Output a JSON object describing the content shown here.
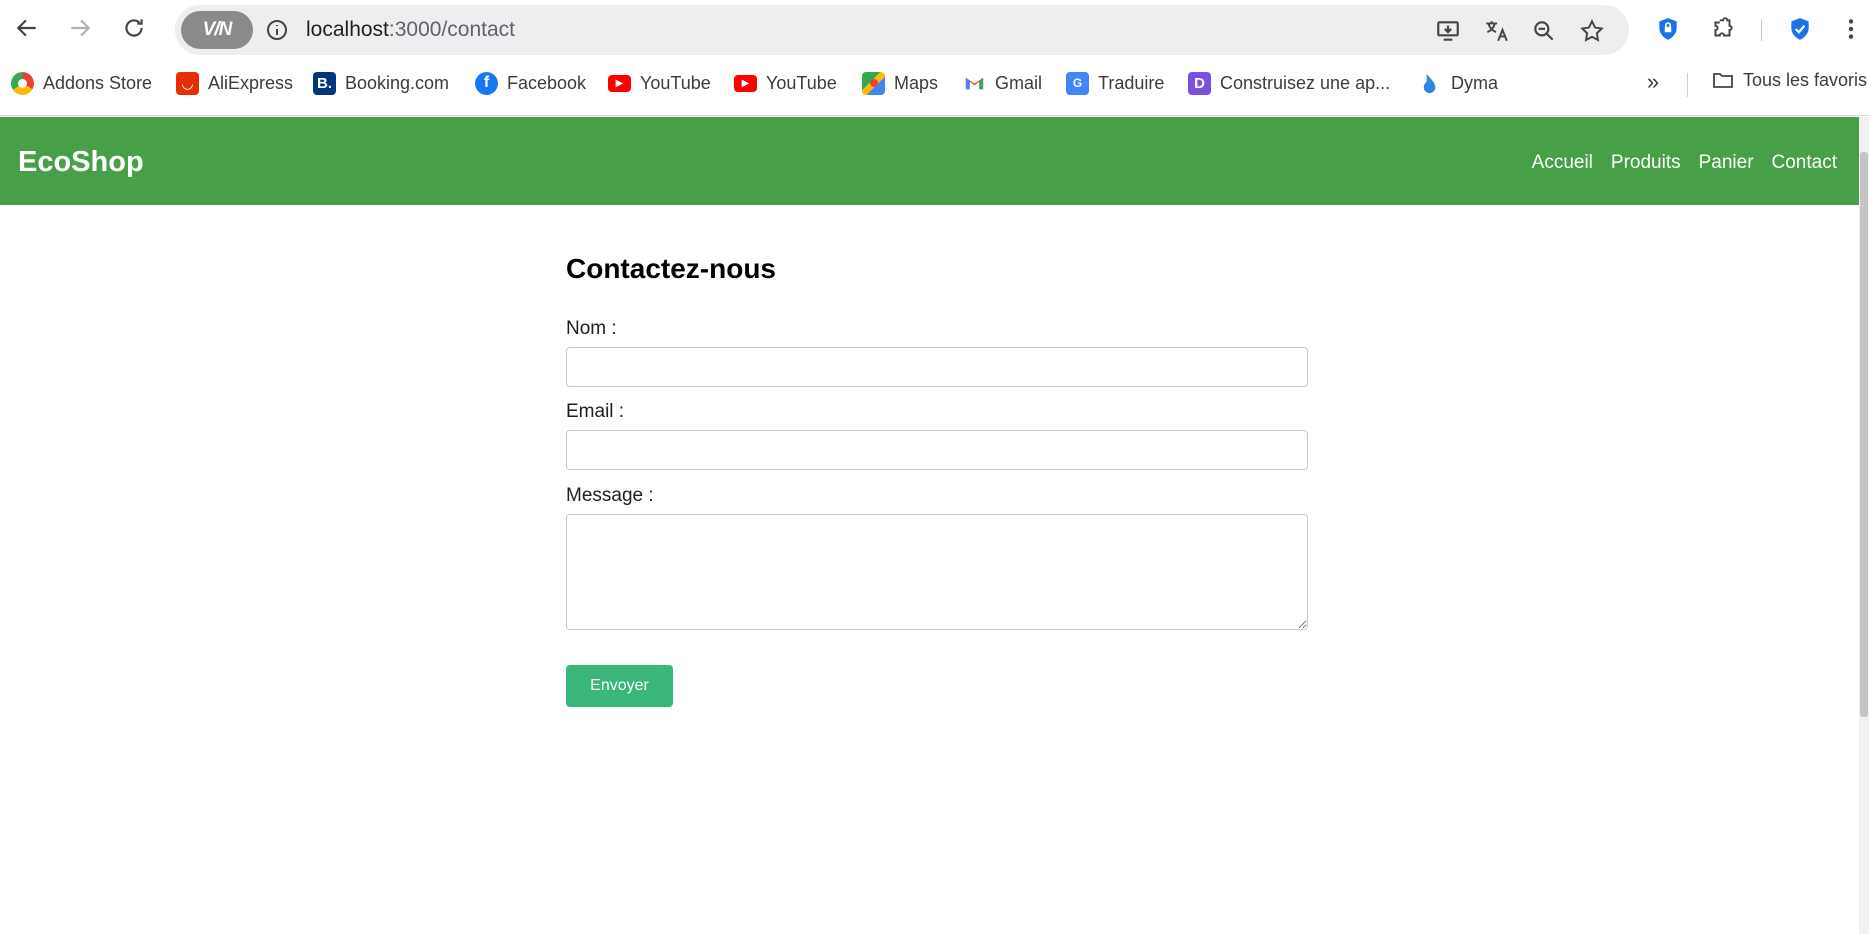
{
  "browser": {
    "vpn_label": "V/N",
    "url_host": "localhost",
    "url_path": ":3000/contact"
  },
  "bookmarks": [
    {
      "label": "Addons Store",
      "icon": "addons-store-icon"
    },
    {
      "label": "AliExpress",
      "icon": "aliexpress-icon"
    },
    {
      "label": "Booking.com",
      "icon": "booking-icon"
    },
    {
      "label": "Facebook",
      "icon": "facebook-icon"
    },
    {
      "label": "YouTube",
      "icon": "youtube-icon"
    },
    {
      "label": "YouTube",
      "icon": "youtube-icon"
    },
    {
      "label": "Maps",
      "icon": "maps-icon"
    },
    {
      "label": "Gmail",
      "icon": "gmail-icon"
    },
    {
      "label": "Traduire",
      "icon": "translate-icon"
    },
    {
      "label": "Construisez une ap...",
      "icon": "construisez-icon"
    },
    {
      "label": "Dyma",
      "icon": "dyma-icon"
    }
  ],
  "bookmarks_more": "»",
  "all_bookmarks_label": "Tous les favoris",
  "site": {
    "logo": "EcoShop",
    "nav": [
      "Accueil",
      "Produits",
      "Panier",
      "Contact"
    ],
    "header_color": "#47a048"
  },
  "contact": {
    "title": "Contactez-nous",
    "name_label": "Nom :",
    "name_value": "",
    "email_label": "Email :",
    "email_value": "",
    "message_label": "Message :",
    "message_value": "",
    "submit_label": "Envoyer",
    "submit_color": "#3bb67b"
  }
}
